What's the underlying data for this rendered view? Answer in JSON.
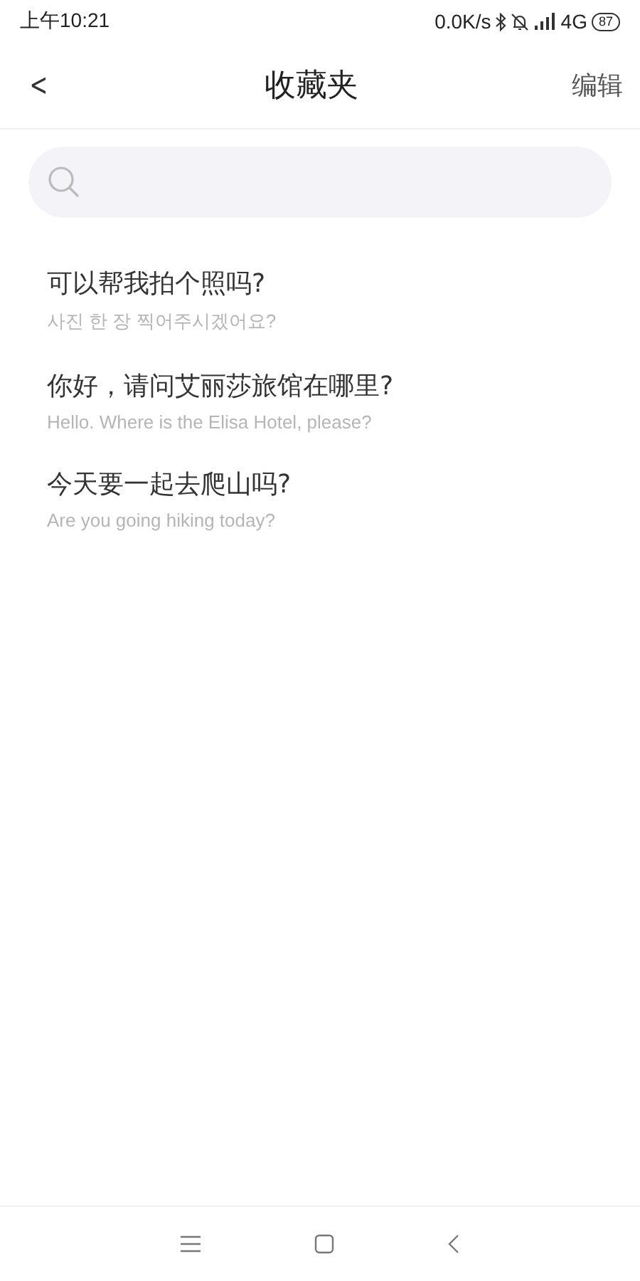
{
  "status_bar": {
    "time": "上午10:21",
    "speed": "0.0K/s",
    "network": "4G",
    "battery": "87"
  },
  "header": {
    "back": "<",
    "title": "收藏夹",
    "action": "编辑"
  },
  "favorites": [
    {
      "phrase": "可以帮我拍个照吗?",
      "translation": "사진 한 장 찍어주시겠어요?"
    },
    {
      "phrase": "你好，请问艾丽莎旅馆在哪里?",
      "translation": "Hello. Where is the Elisa Hotel, please?"
    },
    {
      "phrase": "今天要一起去爬山吗?",
      "translation": "Are you going hiking today?"
    }
  ]
}
